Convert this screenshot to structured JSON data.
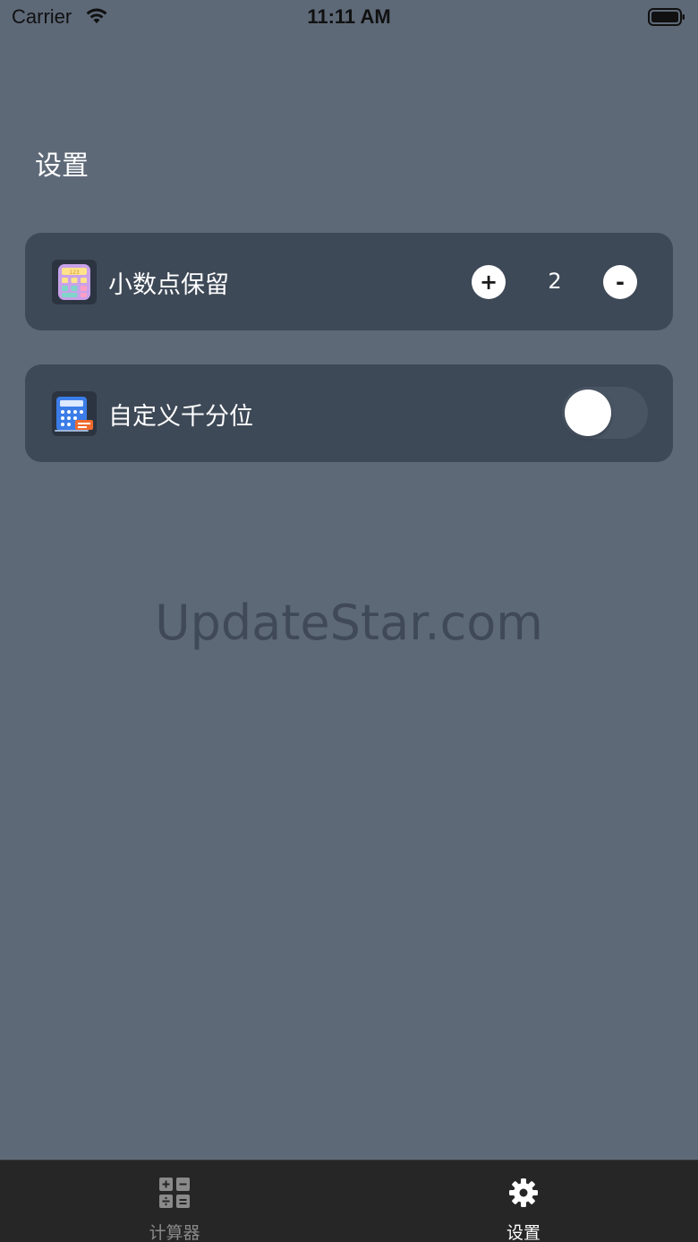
{
  "status_bar": {
    "carrier": "Carrier",
    "time": "11:11 AM",
    "wifi_icon": "wifi-icon",
    "battery_icon": "battery-full-icon"
  },
  "page": {
    "title": "设置"
  },
  "settings": {
    "decimal": {
      "icon": "calculator-pastel-icon",
      "label": "小数点保留",
      "plus_label": "+",
      "value": "2",
      "minus_label": "-"
    },
    "thousand_separator": {
      "icon": "calculator-blue-icon",
      "label": "自定义千分位",
      "enabled": false
    }
  },
  "watermark": "UpdateStar.com",
  "tab_bar": {
    "active": "settings",
    "tabs": [
      {
        "id": "calculator",
        "label": "计算器",
        "icon": "calculator-grid-icon"
      },
      {
        "id": "settings",
        "label": "设置",
        "icon": "gear-icon"
      }
    ]
  },
  "colors": {
    "background": "#5e6978",
    "card": "#3e4957",
    "tab_bar": "#262626",
    "tab_active": "#ffffff",
    "tab_inactive": "#8a8a8a",
    "toggle_track_off": "#4a5564"
  }
}
